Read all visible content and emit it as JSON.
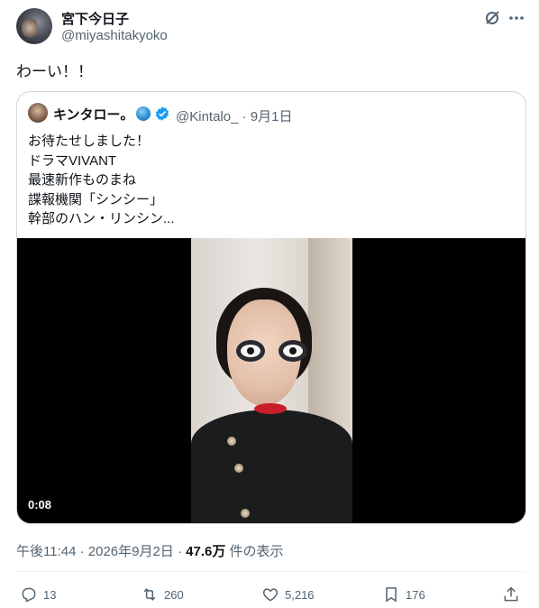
{
  "author": {
    "display_name": "宮下今日子",
    "handle": "@miyashitakyoko"
  },
  "tweet": {
    "text": "わーい！！"
  },
  "quote": {
    "display_name": "キンタロー。",
    "handle_date": "@Kintalo_ · 9月1日",
    "lines": [
      "お待たせしました！",
      "ドラマVIVANT",
      "最速新作ものまね",
      "諜報機関「シンシー」",
      "幹部のハン・リンシン..."
    ],
    "video_duration": "0:08"
  },
  "meta": {
    "time_date": "午後11:44 · 2026年9月2日 · ",
    "views_count": "47.6万",
    "views_label": " 件の表示"
  },
  "actions": {
    "replies": "13",
    "reposts": "260",
    "likes": "5,216",
    "bookmarks": "176"
  },
  "icons": {
    "grok": "grok-icon",
    "more": "more-icon",
    "verified": "verified-badge-icon",
    "globe": "globe-emoji-icon",
    "reply": "reply-icon",
    "repost": "repost-icon",
    "like": "like-icon",
    "bookmark": "bookmark-icon",
    "share": "share-icon"
  },
  "colors": {
    "verified_blue": "#1d9bf0",
    "muted_text": "#536471",
    "border": "#cfd9de"
  }
}
